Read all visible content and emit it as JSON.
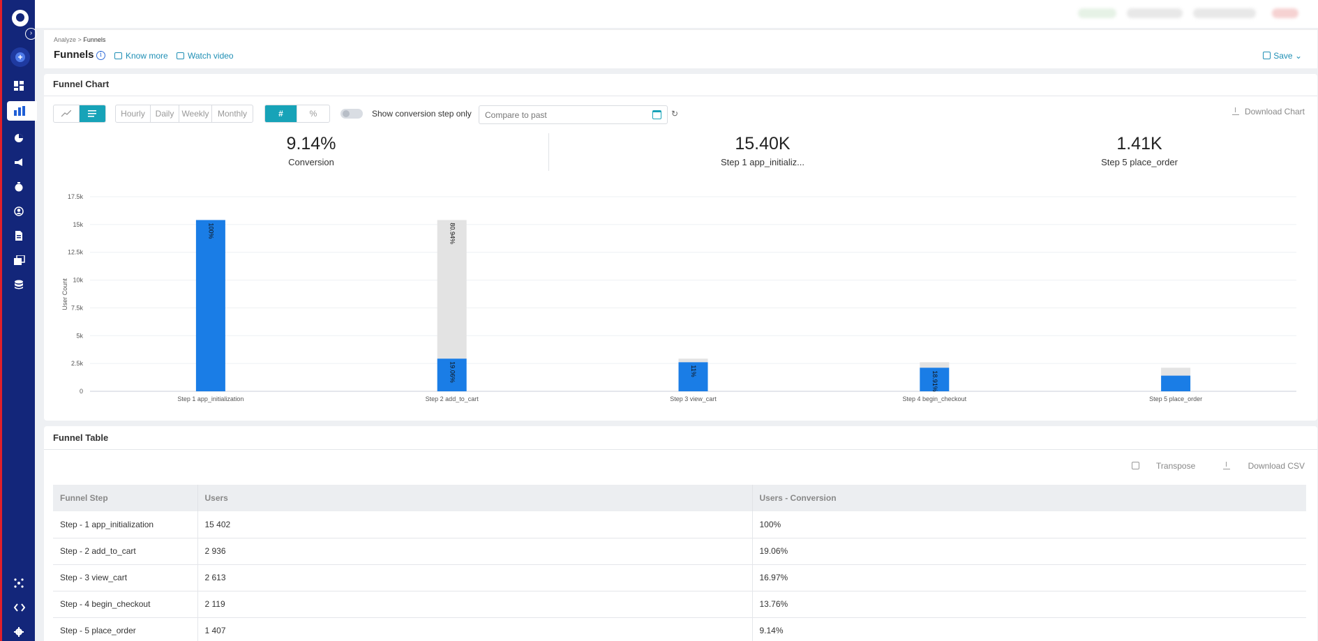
{
  "breadcrumb": {
    "parent": "Analyze",
    "sep": ">",
    "current": "Funnels"
  },
  "header": {
    "title": "Funnels",
    "know_more": "Know more",
    "watch_video": "Watch video",
    "save": "Save"
  },
  "funnel_chart": {
    "title": "Funnel Chart",
    "granularity": [
      "Hourly",
      "Daily",
      "Weekly",
      "Monthly"
    ],
    "mode_count": "#",
    "mode_percent": "%",
    "toggle_label": "Show conversion step only",
    "compare_placeholder": "Compare to past",
    "download_chart": "Download Chart",
    "kpis": [
      {
        "value": "9.14%",
        "label": "Conversion"
      },
      {
        "value": "15.40K",
        "label": "Step 1 app_initializ..."
      },
      {
        "value": "1.41K",
        "label": "Step 5 place_order"
      }
    ]
  },
  "chart_data": {
    "type": "bar",
    "ylabel": "User Count",
    "ylim": [
      0,
      17500
    ],
    "y_ticks": [
      "0",
      "2.5k",
      "5k",
      "7.5k",
      "10k",
      "12.5k",
      "15k",
      "17.5k"
    ],
    "categories": [
      "Step 1 app_initialization",
      "Step 2 add_to_cart",
      "Step 3 view_cart",
      "Step 4 begin_checkout",
      "Step 5 place_order"
    ],
    "series": [
      {
        "values": [
          15402,
          2936,
          2613,
          2119,
          1407
        ],
        "color": "#1a7de6"
      },
      {
        "values": [
          0,
          12466,
          323,
          494,
          712
        ],
        "color": "#e3e3e3"
      }
    ],
    "bar_labels": [
      "100%",
      "19.06%",
      "11%",
      "18.91%",
      ""
    ],
    "drop_labels": [
      "",
      "80.94%",
      "",
      "",
      ""
    ],
    "grid": true
  },
  "funnel_table": {
    "title": "Funnel Table",
    "transpose": "Transpose",
    "download_csv": "Download CSV",
    "columns": [
      "Funnel Step",
      "Users",
      "Users - Conversion"
    ],
    "rows": [
      [
        "Step - 1 app_initialization",
        "15 402",
        "100%"
      ],
      [
        "Step - 2 add_to_cart",
        "2 936",
        "19.06%"
      ],
      [
        "Step - 3 view_cart",
        "2 613",
        "16.97%"
      ],
      [
        "Step - 4 begin_checkout",
        "2 119",
        "13.76%"
      ],
      [
        "Step - 5 place_order",
        "1 407",
        "9.14%"
      ]
    ]
  }
}
